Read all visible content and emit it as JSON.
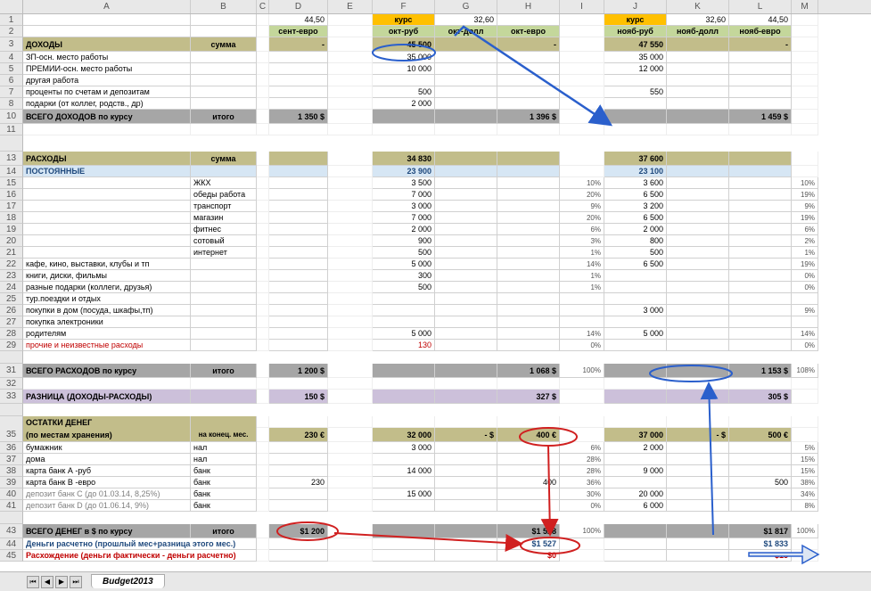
{
  "columns": [
    "A",
    "B",
    "C",
    "D",
    "E",
    "F",
    "G",
    "H",
    "I",
    "J",
    "K",
    "L",
    "M"
  ],
  "r1": {
    "D": "44,50",
    "F_label": "курс",
    "G": "32,60",
    "J_label": "курс",
    "K": "32,60",
    "L": "44,50"
  },
  "r2": {
    "D": "сент-евро",
    "F": "окт-руб",
    "G": "окт-долл",
    "H": "окт-евро",
    "J": "нояб-руб",
    "K": "нояб-долл",
    "L": "нояб-евро"
  },
  "r3": {
    "A": "ДОХОДЫ",
    "B": "сумма",
    "D": "-",
    "F": "45 500",
    "H": "-",
    "J": "47 550",
    "L": "-"
  },
  "r4": {
    "A": "ЗП-осн. место работы",
    "F": "35 000",
    "J": "35 000"
  },
  "r5": {
    "A": "ПРЕМИИ-осн. место работы",
    "F": "10 000",
    "J": "12 000"
  },
  "r6": {
    "A": "другая работа"
  },
  "r7": {
    "A": "проценты по счетам и депозитам",
    "F": "500",
    "J": "550"
  },
  "r8": {
    "A": "подарки (от коллег, родств., др)",
    "F": "2 000"
  },
  "r10": {
    "A": "ВСЕГО ДОХОДОВ по курсу",
    "B": "итого",
    "D": "1 350 $",
    "H": "1 396 $",
    "L": "1 459 $"
  },
  "r13": {
    "A": "РАСХОДЫ",
    "B": "сумма",
    "F": "34 830",
    "J": "37 600"
  },
  "r14": {
    "A": "ПОСТОЯННЫЕ",
    "F": "23 900",
    "J": "23 100"
  },
  "r15": {
    "B": "ЖКХ",
    "F": "3 500",
    "I": "10%",
    "J": "3 600",
    "M": "10%"
  },
  "r16": {
    "B": "обеды работа",
    "F": "7 000",
    "I": "20%",
    "J": "6 500",
    "M": "19%"
  },
  "r17": {
    "B": "транспорт",
    "F": "3 000",
    "I": "9%",
    "J": "3 200",
    "M": "9%"
  },
  "r18": {
    "B": "магазин",
    "F": "7 000",
    "I": "20%",
    "J": "6 500",
    "M": "19%"
  },
  "r19": {
    "B": "фитнес",
    "F": "2 000",
    "I": "6%",
    "J": "2 000",
    "M": "6%"
  },
  "r20": {
    "B": "сотовый",
    "F": "900",
    "I": "3%",
    "J": "800",
    "M": "2%"
  },
  "r21": {
    "B": "интернет",
    "F": "500",
    "I": "1%",
    "J": "500",
    "M": "1%"
  },
  "r22": {
    "A": "кафе, кино, выставки, клубы и тп",
    "F": "5 000",
    "I": "14%",
    "J": "6 500",
    "M": "19%"
  },
  "r23": {
    "A": "книги, диски, фильмы",
    "F": "300",
    "I": "1%",
    "M": "0%"
  },
  "r24": {
    "A": "разные подарки (коллеги, друзья)",
    "F": "500",
    "I": "1%",
    "M": "0%"
  },
  "r25": {
    "A": "тур.поездки и отдых"
  },
  "r26": {
    "A": "покупки в дом (посуда, шкафы,тп)",
    "J": "3 000",
    "M": "9%"
  },
  "r27": {
    "A": "покупка электроники"
  },
  "r28": {
    "A": "родителям",
    "F": "5 000",
    "I": "14%",
    "J": "5 000",
    "M": "14%"
  },
  "r29": {
    "A": "прочие и неизвестные расходы",
    "F": "130",
    "I": "0%",
    "M": "0%"
  },
  "r31": {
    "A": "ВСЕГО РАСХОДОВ по курсу",
    "B": "итого",
    "D": "1 200 $",
    "H": "1 068 $",
    "I": "100%",
    "L": "1 153 $",
    "M": "108%"
  },
  "r33": {
    "A": "РАЗНИЦА (ДОХОДЫ-РАСХОДЫ)",
    "D": "150 $",
    "H": "327 $",
    "L": "305 $"
  },
  "r35": {
    "A": "ОСТАТКИ ДЕНЕГ",
    "A2": "(по местам хранения)",
    "B": "на конец. мес.",
    "D": "230 €",
    "F": "32 000",
    "G": "- $",
    "H": "400 €",
    "J": "37 000",
    "K": "- $",
    "L": "500 €"
  },
  "r36": {
    "A": "бумажник",
    "B": "нал",
    "F": "3 000",
    "I": "6%",
    "J": "2 000",
    "M": "5%"
  },
  "r37": {
    "A": "дома",
    "B": "нал",
    "I": "28%",
    "M": "15%"
  },
  "r38": {
    "A": "карта банк А -руб",
    "B": "банк",
    "F": "14 000",
    "I": "28%",
    "J": "9 000",
    "M": "15%"
  },
  "r39": {
    "A": "карта банк В -евро",
    "B": "банк",
    "D": "230",
    "H": "400",
    "I": "36%",
    "L": "500",
    "M": "38%"
  },
  "r40": {
    "A": "депозит банк С (до 01.03.14, 8,25%)",
    "B": "банк",
    "F": "15 000",
    "I": "30%",
    "J": "20 000",
    "M": "34%"
  },
  "r41": {
    "A": "депозит банк D (до 01.06.14, 9%)",
    "B": "банк",
    "I": "0%",
    "J": "6 000",
    "M": "8%"
  },
  "r43": {
    "A": "ВСЕГО ДЕНЕГ в $ по курсу",
    "B": "итого",
    "D": "$1 200",
    "H": "$1 528",
    "I": "100%",
    "L": "$1 817",
    "M": "100%"
  },
  "r44": {
    "A": "Деньги расчетно (прошлый мес+разница этого мес.)",
    "H": "$1 527",
    "L": "$1 833"
  },
  "r45": {
    "A": "Расхождение (деньги фактически - деньги расчетно)",
    "H": "$0",
    "L": "-$15"
  },
  "tab": "Budget2013"
}
